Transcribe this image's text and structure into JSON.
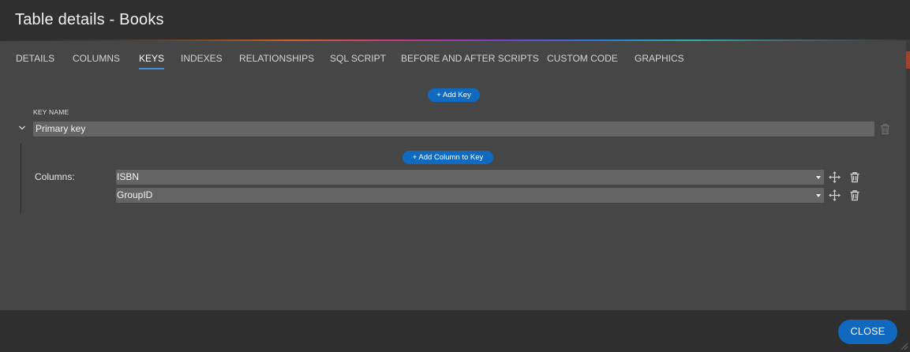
{
  "header": {
    "title": "Table details - Books"
  },
  "tabs": [
    {
      "label": "DETAILS",
      "active": false
    },
    {
      "label": "COLUMNS",
      "active": false
    },
    {
      "label": "KEYS",
      "active": true
    },
    {
      "label": "INDEXES",
      "active": false
    },
    {
      "label": "RELATIONSHIPS",
      "active": false
    },
    {
      "label": "SQL SCRIPT",
      "active": false
    },
    {
      "label": "BEFORE AND AFTER SCRIPTS",
      "active": false
    },
    {
      "label": "CUSTOM CODE",
      "active": false
    },
    {
      "label": "GRAPHICS",
      "active": false
    }
  ],
  "keys": {
    "add_key_label": "+ Add Key",
    "key_name_header": "KEY NAME",
    "items": [
      {
        "name": "Primary key",
        "expanded": true,
        "add_column_label": "+ Add Column to Key",
        "columns_label": "Columns:",
        "columns": [
          {
            "value": "ISBN"
          },
          {
            "value": "GroupID"
          }
        ]
      }
    ]
  },
  "footer": {
    "close_label": "CLOSE"
  },
  "icons": {
    "expand": "chevron-down-icon",
    "delete": "trash-icon",
    "reorder": "move-icon",
    "dropdown": "caret-down-icon"
  },
  "colors": {
    "accent": "#1169bf",
    "active_tab_underline": "#3d8fe0",
    "panel": "#464646",
    "header": "#2f2f2f"
  }
}
